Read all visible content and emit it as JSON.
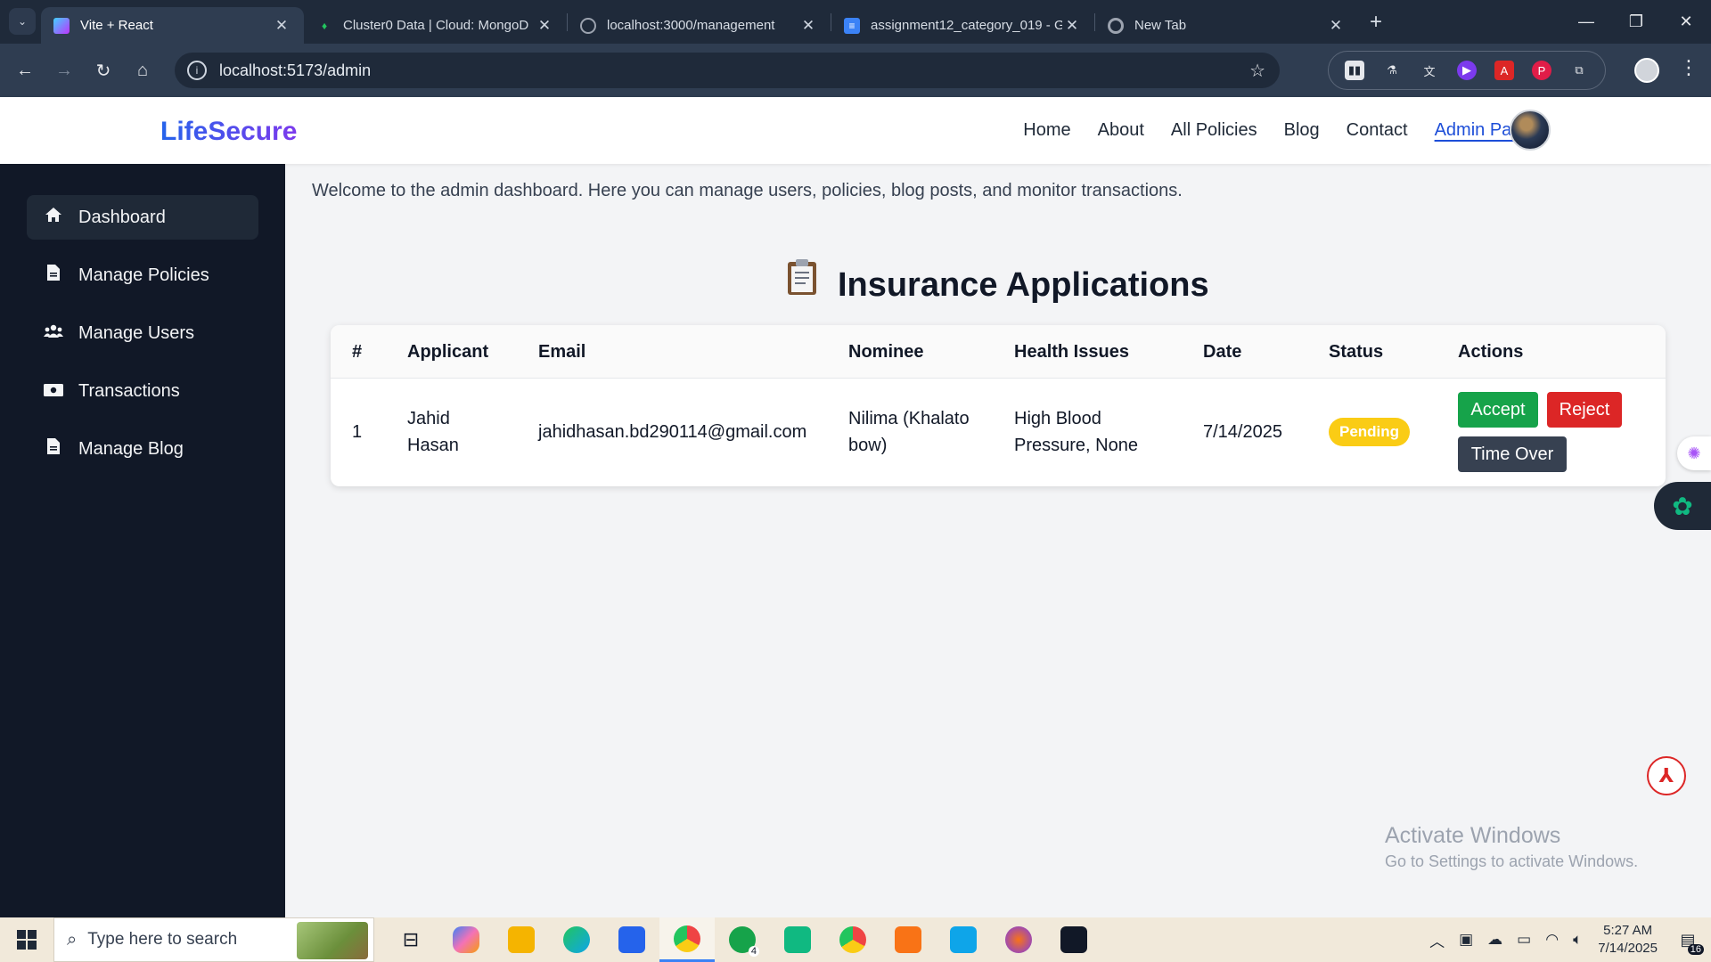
{
  "browser": {
    "tabs": [
      {
        "title": "Vite + React",
        "active": true,
        "favicon": "vite-icon"
      },
      {
        "title": "Cluster0 Data | Cloud: MongoD",
        "active": false,
        "favicon": "mongodb-leaf-icon"
      },
      {
        "title": "localhost:3000/management",
        "active": false,
        "favicon": "globe-icon"
      },
      {
        "title": "assignment12_category_019 - G",
        "active": false,
        "favicon": "google-docs-icon"
      },
      {
        "title": "New Tab",
        "active": false,
        "favicon": "chrome-icon"
      }
    ],
    "url": "localhost:5173/admin"
  },
  "header": {
    "logo": "LifeSecure",
    "nav": [
      {
        "label": "Home",
        "active": false
      },
      {
        "label": "About",
        "active": false
      },
      {
        "label": "All Policies",
        "active": false
      },
      {
        "label": "Blog",
        "active": false
      },
      {
        "label": "Contact",
        "active": false
      },
      {
        "label": "Admin Panel",
        "active": true
      }
    ]
  },
  "sidebar": {
    "items": [
      {
        "label": "Dashboard",
        "icon": "home-icon",
        "active": true
      },
      {
        "label": "Manage Policies",
        "icon": "document-icon",
        "active": false
      },
      {
        "label": "Manage Users",
        "icon": "users-icon",
        "active": false
      },
      {
        "label": "Transactions",
        "icon": "money-icon",
        "active": false
      },
      {
        "label": "Manage Blog",
        "icon": "document-icon",
        "active": false
      }
    ]
  },
  "main": {
    "welcome": "Welcome to the admin dashboard. Here you can manage users, policies, blog posts, and monitor transactions.",
    "section_title": "Insurance Applications",
    "section_icon": "clipboard-icon",
    "table": {
      "headers": [
        "#",
        "Applicant",
        "Email",
        "Nominee",
        "Health Issues",
        "Date",
        "Status",
        "Actions"
      ],
      "rows": [
        {
          "index": "1",
          "applicant_line1": "Jahid",
          "applicant_line2": "Hasan",
          "email": "jahidhasan.bd290114@gmail.com",
          "nominee_line1": "Nilima (Khalato",
          "nominee_line2": "bow)",
          "health_line1": "High Blood",
          "health_line2": "Pressure, None",
          "date": "7/14/2025",
          "status": "Pending",
          "actions": {
            "accept": "Accept",
            "reject": "Reject",
            "time_over": "Time Over"
          }
        }
      ]
    }
  },
  "watermark": {
    "line1": "Activate Windows",
    "line2": "Go to Settings to activate Windows."
  },
  "taskbar": {
    "search_placeholder": "Type here to search",
    "time": "5:27 AM",
    "date": "7/14/2025",
    "whatsapp_badge": "4",
    "notification_count": "16"
  },
  "colors": {
    "sidebar_bg": "#111827",
    "accept": "#16a34a",
    "reject": "#dc2626",
    "time_over": "#374151",
    "pending": "#facc15",
    "nav_active": "#1d4ed8"
  }
}
